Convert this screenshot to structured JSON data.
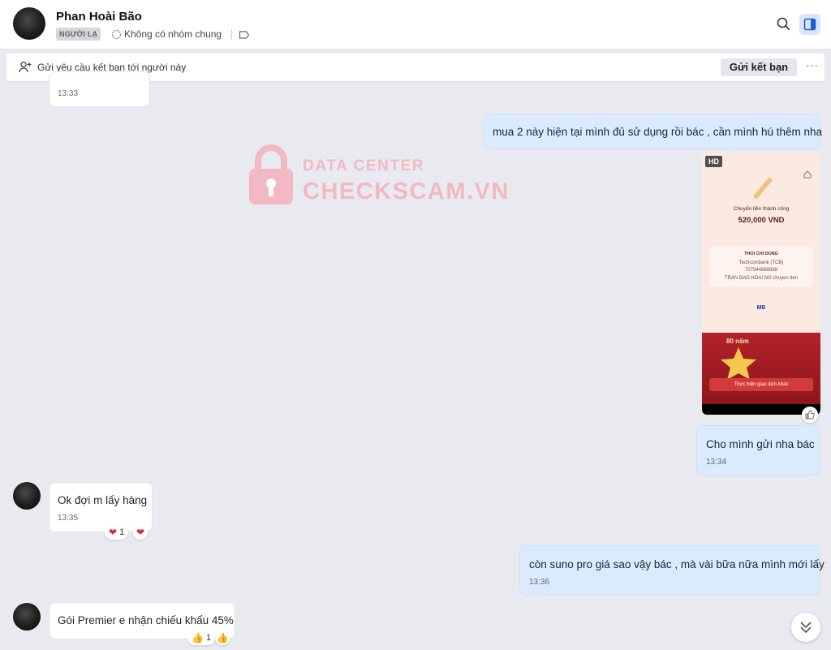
{
  "header": {
    "name": "Phan Hoài Bão",
    "badge": "NGƯỜI LẠ",
    "group_text": "Không có nhóm chung"
  },
  "friend_bar": {
    "text": "Gửi yêu cầu kết bạn tới người này",
    "button": "Gửi kết bạn",
    "more": "···"
  },
  "watermark": {
    "top": "DATA CENTER",
    "bottom": "CHECKSCAM.VN"
  },
  "messages": [
    {
      "text": "",
      "time": "13:33"
    },
    {
      "text": "mua 2 này hiện tại mình đủ sử dụng rồi bác , cần mình hú thêm nha"
    },
    {
      "text": "Cho mình gửi nha bác",
      "time": "13:34"
    },
    {
      "text": "Ok đợi m lấy hàng",
      "time": "13:35",
      "reaction_count": "1"
    },
    {
      "text": "còn suno pro giá sao vậy bác , mà vài bữa nữa mình mới lấy",
      "time": "13:36"
    },
    {
      "text": "Gói Premier e nhận chiếu khấu 45%",
      "reaction_count": "1"
    }
  ],
  "image": {
    "hd": "HD",
    "title": "Chuyển tiền thành công",
    "amount": "520,000 VND",
    "recipient": "THOI CHI DUNG",
    "bank": "Techcombank (TCB)",
    "account": "707944888888",
    "note": "TRAN BAO HOAI NO chuyen tien",
    "mb": "MB",
    "promo": "80 năm",
    "button": "Thực hiện giao dịch khác"
  },
  "colors": {
    "background": "#e9eaef",
    "sent_bubble": "#dbebff",
    "received_bubble": "#ffffff",
    "watermark": "#f2b8c4",
    "accent": "#1a5fd6"
  }
}
